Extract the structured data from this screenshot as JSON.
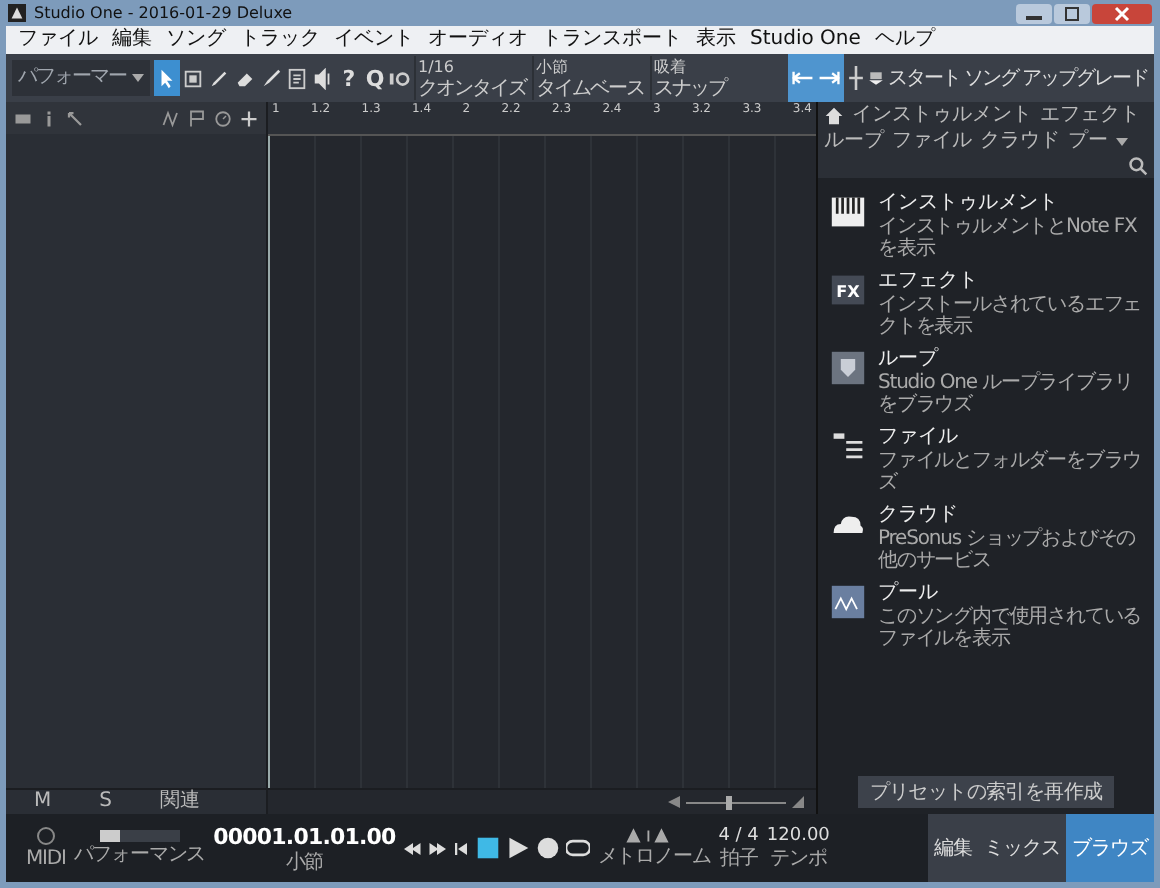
{
  "window": {
    "title": "Studio One - 2016-01-29 Deluxe"
  },
  "menu": [
    "ファイル",
    "編集",
    "ソング",
    "トラック",
    "イベント",
    "オーディオ",
    "トランスポート",
    "表示",
    "Studio One",
    "ヘルプ"
  ],
  "toolbar": {
    "preset": {
      "placeholder": "パフォーマー"
    },
    "tools": [
      {
        "kind": "arrow",
        "selected": true
      },
      {
        "kind": "range",
        "selected": false
      },
      {
        "kind": "pencil",
        "selected": false
      },
      {
        "kind": "eraser",
        "selected": false
      },
      {
        "kind": "brush",
        "selected": false
      },
      {
        "kind": "note",
        "selected": false
      },
      {
        "kind": "speaker",
        "selected": false
      }
    ],
    "help_glyph": "?",
    "quantize_glyph": "Q",
    "dropdowns": [
      {
        "value": "1/16",
        "label": "クオンタイズ"
      },
      {
        "value": "小節",
        "label": "タイムベース"
      },
      {
        "value": "吸着",
        "label": "スナップ"
      }
    ],
    "links": [
      "スタート",
      "ソング",
      "アップグレード"
    ]
  },
  "ruler": [
    "1",
    "1.2",
    "1.3",
    "1.4",
    "2",
    "2.2",
    "2.3",
    "2.4",
    "3",
    "3.2",
    "3.3",
    "3.4"
  ],
  "browser": {
    "tabs": [
      "インストゥルメント",
      "エフェクト",
      "ループ",
      "ファイル",
      "クラウド",
      "プー"
    ],
    "items": [
      {
        "kind": "instrument",
        "title": "インストゥルメント",
        "desc": "インストゥルメントとNote FXを表示"
      },
      {
        "kind": "effect",
        "icon_label": "FX",
        "title": "エフェクト",
        "desc": "インストールされているエフェクトを表示"
      },
      {
        "kind": "loop",
        "title": "ループ",
        "desc": "Studio One ループライブラリをブラウズ"
      },
      {
        "kind": "file",
        "title": "ファイル",
        "desc": "ファイルとフォルダーをブラウズ"
      },
      {
        "kind": "cloud",
        "title": "クラウド",
        "desc": "PreSonus ショップおよびその他のサービス"
      },
      {
        "kind": "pool",
        "title": "プール",
        "desc": "このソング内で使用されているファイルを表示"
      }
    ],
    "rebuild_button": "プリセットの索引を再作成"
  },
  "track_footer": [
    "M",
    "S",
    "関連"
  ],
  "zoom": {
    "level": 0.4
  },
  "transport": {
    "midi_label": "MIDI",
    "performance_label": "パフォーマンス",
    "time": "00001.01.01.00",
    "time_unit": "小節",
    "stopped": true,
    "metronome_label": "メトロノーム",
    "signature": "4 / 4",
    "signature_label": "拍子",
    "tempo": "120.00",
    "tempo_label": "テンポ"
  },
  "views": [
    {
      "label": "編集",
      "selected": false
    },
    {
      "label": "ミックス",
      "selected": false
    },
    {
      "label": "ブラウズ",
      "selected": true
    }
  ]
}
